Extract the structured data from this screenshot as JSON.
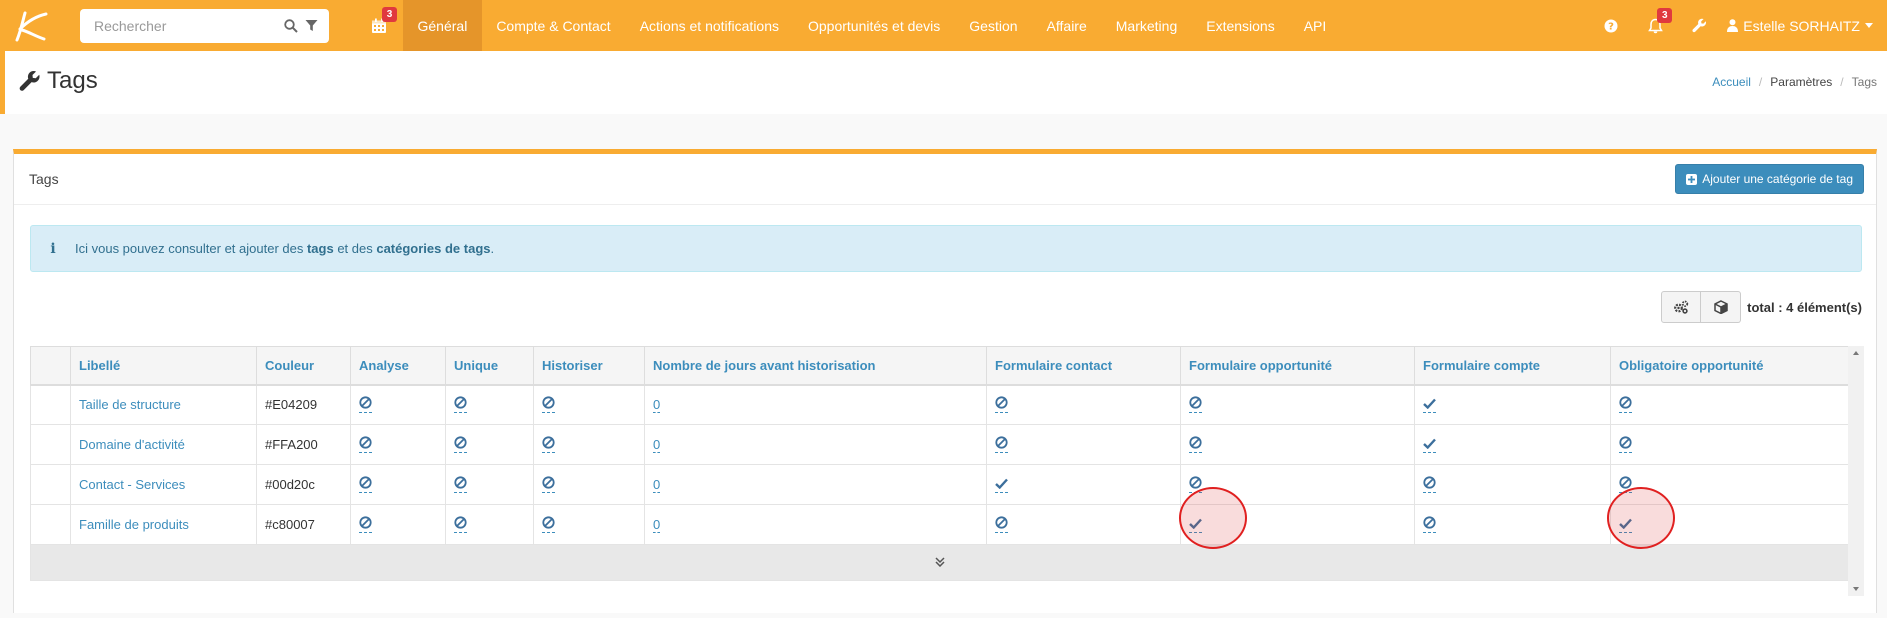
{
  "topbar": {
    "search_placeholder": "Rechercher",
    "calendar_badge": "3",
    "nav": [
      "Général",
      "Compte & Contact",
      "Actions et notifications",
      "Opportunités et devis",
      "Gestion",
      "Affaire",
      "Marketing",
      "Extensions",
      "API"
    ],
    "active_index": 0,
    "notifications_badge": "3",
    "user_name": "Estelle SORHAITZ"
  },
  "page": {
    "title": "Tags",
    "breadcrumb": [
      "Accueil",
      "Paramètres",
      "Tags"
    ]
  },
  "box": {
    "title": "Tags",
    "add_button": "Ajouter une catégorie de tag",
    "info": {
      "prefix": "Ici vous pouvez consulter et ajouter des ",
      "bold1": "tags",
      "middle": " et des ",
      "bold2": "catégories de tags",
      "suffix": "."
    },
    "total": "total : 4 élément(s)"
  },
  "table": {
    "columns": [
      "",
      "Libellé",
      "Couleur",
      "Analyse",
      "Unique",
      "Historiser",
      "Nombre de jours avant historisation",
      "Formulaire contact",
      "Formulaire opportunité",
      "Formulaire compte",
      "Obligatoire opportunité"
    ],
    "rows": [
      {
        "label": "Taille de structure",
        "color": "#E04209",
        "analyse": "no",
        "unique": "no",
        "historiser": "no",
        "days": "0",
        "f_contact": "no",
        "f_opp": "no",
        "f_compte": "yes",
        "oblig_opp": "no"
      },
      {
        "label": "Domaine d'activité",
        "color": "#FFA200",
        "analyse": "no",
        "unique": "no",
        "historiser": "no",
        "days": "0",
        "f_contact": "no",
        "f_opp": "no",
        "f_compte": "yes",
        "oblig_opp": "no"
      },
      {
        "label": "Contact - Services",
        "color": "#00d20c",
        "analyse": "no",
        "unique": "no",
        "historiser": "no",
        "days": "0",
        "f_contact": "yes",
        "f_opp": "no",
        "f_compte": "no",
        "oblig_opp": "no"
      },
      {
        "label": "Famille de produits",
        "color": "#c80007",
        "analyse": "no",
        "unique": "no",
        "historiser": "no",
        "days": "0",
        "f_contact": "no",
        "f_opp": "yes",
        "f_compte": "no",
        "oblig_opp": "yes"
      }
    ]
  },
  "colors": {
    "topbar": "#f9ab32",
    "active_nav": "#e5952a",
    "link": "#3c8dbc",
    "badge": "#e0393e",
    "highlight_circle": "#e02020"
  },
  "icons": {
    "yes": "check-icon",
    "no": "ban-icon"
  }
}
